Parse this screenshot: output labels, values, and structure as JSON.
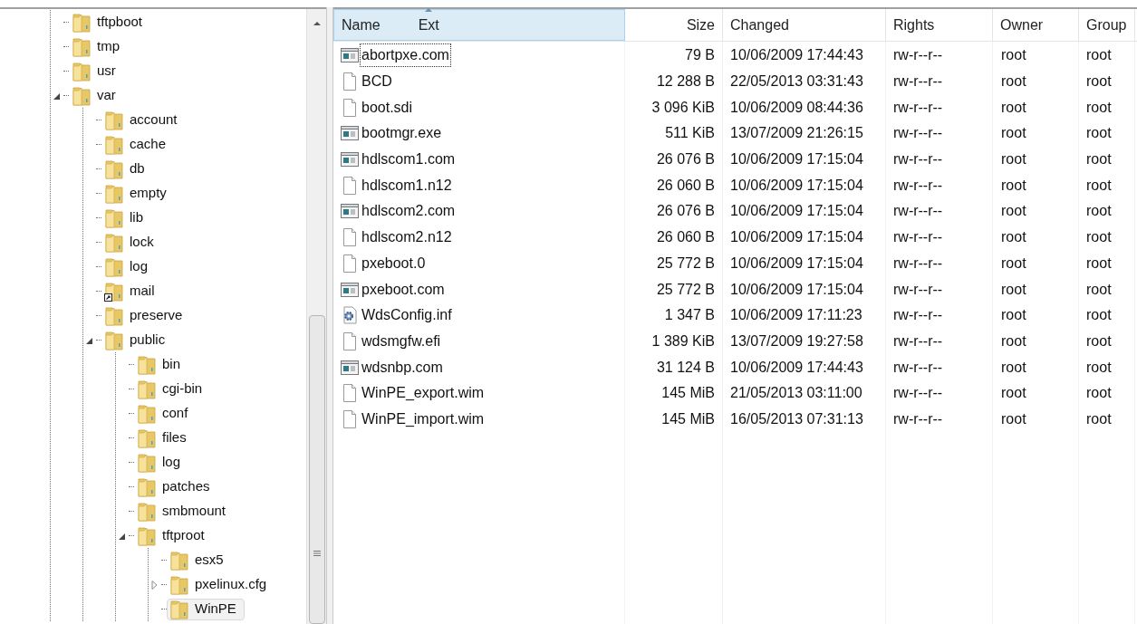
{
  "tree": [
    {
      "label": "tftpboot",
      "kind": "leaf",
      "selected": false,
      "shortcut": false
    },
    {
      "label": "tmp",
      "kind": "leaf",
      "selected": false,
      "shortcut": false
    },
    {
      "label": "usr",
      "kind": "leaf",
      "selected": false,
      "shortcut": false
    },
    {
      "label": "var",
      "kind": "branch",
      "expanded": true,
      "selected": false,
      "shortcut": false,
      "children": [
        {
          "label": "account",
          "kind": "leaf",
          "selected": false,
          "shortcut": false
        },
        {
          "label": "cache",
          "kind": "leaf",
          "selected": false,
          "shortcut": false
        },
        {
          "label": "db",
          "kind": "leaf",
          "selected": false,
          "shortcut": false
        },
        {
          "label": "empty",
          "kind": "leaf",
          "selected": false,
          "shortcut": false
        },
        {
          "label": "lib",
          "kind": "leaf",
          "selected": false,
          "shortcut": false
        },
        {
          "label": "lock",
          "kind": "leaf",
          "selected": false,
          "shortcut": false
        },
        {
          "label": "log",
          "kind": "leaf",
          "selected": false,
          "shortcut": false
        },
        {
          "label": "mail",
          "kind": "leaf",
          "selected": false,
          "shortcut": true
        },
        {
          "label": "preserve",
          "kind": "leaf",
          "selected": false,
          "shortcut": false
        },
        {
          "label": "public",
          "kind": "branch",
          "expanded": true,
          "selected": false,
          "shortcut": false,
          "children": [
            {
              "label": "bin",
              "kind": "leaf",
              "selected": false,
              "shortcut": false
            },
            {
              "label": "cgi-bin",
              "kind": "leaf",
              "selected": false,
              "shortcut": false
            },
            {
              "label": "conf",
              "kind": "leaf",
              "selected": false,
              "shortcut": false
            },
            {
              "label": "files",
              "kind": "leaf",
              "selected": false,
              "shortcut": false
            },
            {
              "label": "log",
              "kind": "leaf",
              "selected": false,
              "shortcut": false
            },
            {
              "label": "patches",
              "kind": "leaf",
              "selected": false,
              "shortcut": false
            },
            {
              "label": "smbmount",
              "kind": "leaf",
              "selected": false,
              "shortcut": false
            },
            {
              "label": "tftproot",
              "kind": "branch",
              "expanded": true,
              "selected": false,
              "shortcut": false,
              "children": [
                {
                  "label": "esx5",
                  "kind": "leaf",
                  "selected": false,
                  "shortcut": false
                },
                {
                  "label": "pxelinux.cfg",
                  "kind": "branch",
                  "expanded": false,
                  "selected": false,
                  "shortcut": false
                },
                {
                  "label": "WinPE",
                  "kind": "leaf",
                  "selected": true,
                  "shortcut": false
                }
              ]
            }
          ]
        }
      ]
    }
  ],
  "columns": [
    {
      "label": "Name",
      "sorted": false
    },
    {
      "label": "Ext",
      "sorted": true
    },
    {
      "label": "Size",
      "sorted": false
    },
    {
      "label": "Changed",
      "sorted": false
    },
    {
      "label": "Rights",
      "sorted": false
    },
    {
      "label": "Owner",
      "sorted": false
    },
    {
      "label": "Group",
      "sorted": false
    }
  ],
  "files": [
    {
      "kind": "program",
      "name": "abortpxe.com",
      "size": "79 B",
      "changed": "10/06/2009 17:44:43",
      "rights": "rw-r--r--",
      "owner": "root",
      "group": "root",
      "focused": true
    },
    {
      "kind": "file",
      "name": "BCD",
      "size": "12 288 B",
      "changed": "22/05/2013 03:31:43",
      "rights": "rw-r--r--",
      "owner": "root",
      "group": "root",
      "focused": false
    },
    {
      "kind": "file",
      "name": "boot.sdi",
      "size": "3 096 KiB",
      "changed": "10/06/2009 08:44:36",
      "rights": "rw-r--r--",
      "owner": "root",
      "group": "root",
      "focused": false
    },
    {
      "kind": "program",
      "name": "bootmgr.exe",
      "size": "511 KiB",
      "changed": "13/07/2009 21:26:15",
      "rights": "rw-r--r--",
      "owner": "root",
      "group": "root",
      "focused": false
    },
    {
      "kind": "program",
      "name": "hdlscom1.com",
      "size": "26 076 B",
      "changed": "10/06/2009 17:15:04",
      "rights": "rw-r--r--",
      "owner": "root",
      "group": "root",
      "focused": false
    },
    {
      "kind": "file",
      "name": "hdlscom1.n12",
      "size": "26 060 B",
      "changed": "10/06/2009 17:15:04",
      "rights": "rw-r--r--",
      "owner": "root",
      "group": "root",
      "focused": false
    },
    {
      "kind": "program",
      "name": "hdlscom2.com",
      "size": "26 076 B",
      "changed": "10/06/2009 17:15:04",
      "rights": "rw-r--r--",
      "owner": "root",
      "group": "root",
      "focused": false
    },
    {
      "kind": "file",
      "name": "hdlscom2.n12",
      "size": "26 060 B",
      "changed": "10/06/2009 17:15:04",
      "rights": "rw-r--r--",
      "owner": "root",
      "group": "root",
      "focused": false
    },
    {
      "kind": "file",
      "name": "pxeboot.0",
      "size": "25 772 B",
      "changed": "10/06/2009 17:15:04",
      "rights": "rw-r--r--",
      "owner": "root",
      "group": "root",
      "focused": false
    },
    {
      "kind": "program",
      "name": "pxeboot.com",
      "size": "25 772 B",
      "changed": "10/06/2009 17:15:04",
      "rights": "rw-r--r--",
      "owner": "root",
      "group": "root",
      "focused": false
    },
    {
      "kind": "config",
      "name": "WdsConfig.inf",
      "size": "1 347 B",
      "changed": "10/06/2009 17:11:23",
      "rights": "rw-r--r--",
      "owner": "root",
      "group": "root",
      "focused": false
    },
    {
      "kind": "file",
      "name": "wdsmgfw.efi",
      "size": "1 389 KiB",
      "changed": "13/07/2009 19:27:58",
      "rights": "rw-r--r--",
      "owner": "root",
      "group": "root",
      "focused": false
    },
    {
      "kind": "program",
      "name": "wdsnbp.com",
      "size": "31 124 B",
      "changed": "10/06/2009 17:44:43",
      "rights": "rw-r--r--",
      "owner": "root",
      "group": "root",
      "focused": false
    },
    {
      "kind": "file",
      "name": "WinPE_export.wim",
      "size": "145 MiB",
      "changed": "21/05/2013 03:11:00",
      "rights": "rw-r--r--",
      "owner": "root",
      "group": "root",
      "focused": false
    },
    {
      "kind": "file",
      "name": "WinPE_import.wim",
      "size": "145 MiB",
      "changed": "16/05/2013 07:31:13",
      "rights": "rw-r--r--",
      "owner": "root",
      "group": "root",
      "focused": false
    }
  ]
}
